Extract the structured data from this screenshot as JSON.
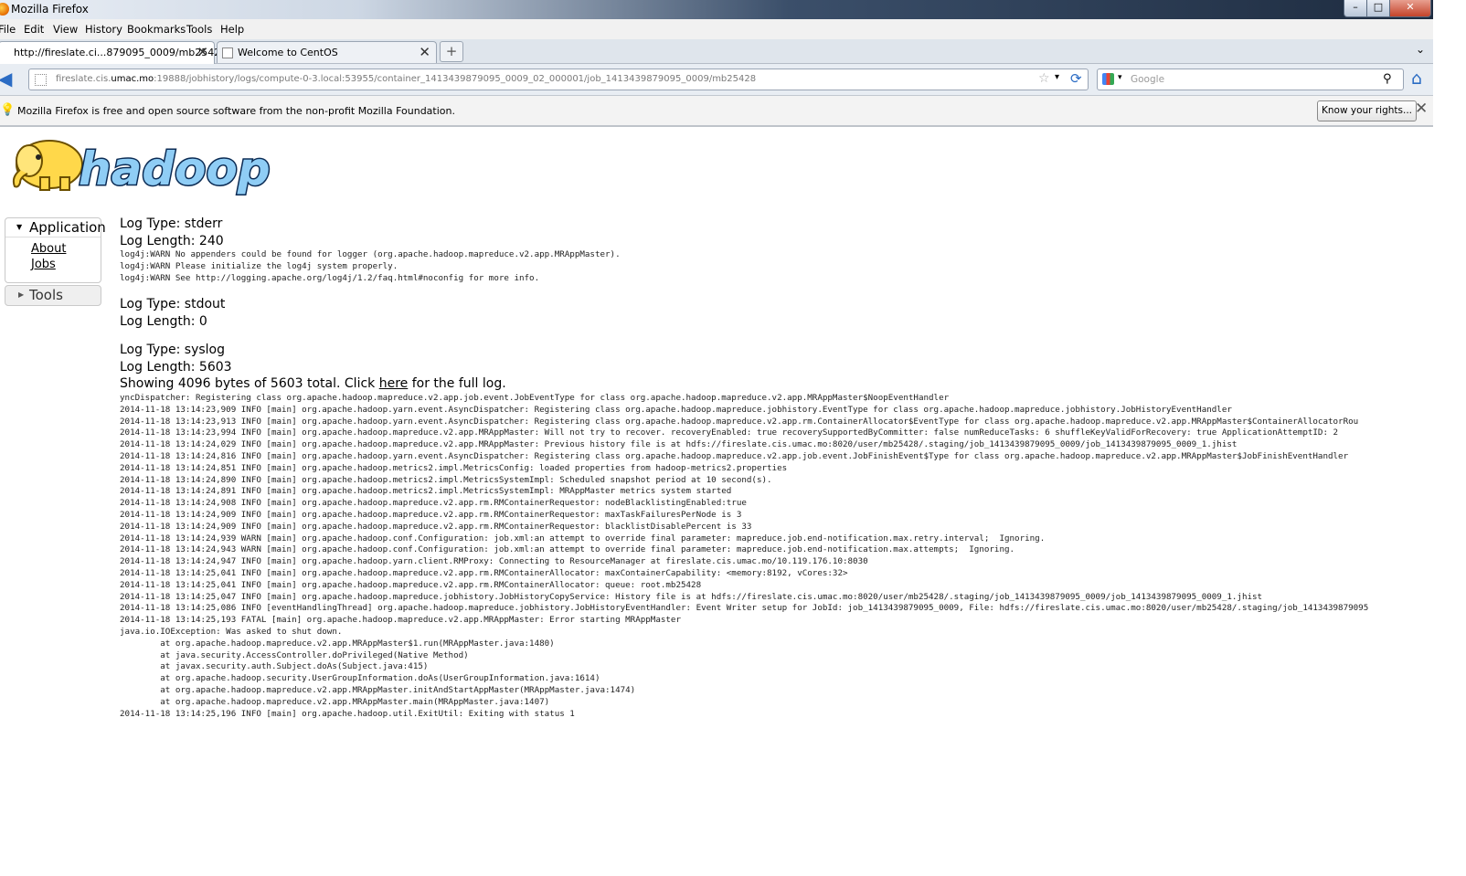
{
  "window": {
    "title": "Mozilla Firefox",
    "min": "–",
    "max": "□",
    "close": "✕"
  },
  "menu": [
    "File",
    "Edit",
    "View",
    "History",
    "Bookmarks",
    "Tools",
    "Help"
  ],
  "tabs": [
    {
      "label": "http://fireslate.ci...879095_0009/mb25428",
      "active": true
    },
    {
      "label": "Welcome to CentOS",
      "active": false
    }
  ],
  "newtab_label": "+",
  "nav": {
    "url_prefix": "fireslate.cis.",
    "url_host": "umac.mo",
    "url_rest": ":19888/jobhistory/logs/compute-0-3.local:53955/container_1413439879095_0009_02_000001/job_1413439879095_0009/mb25428",
    "search_placeholder": "Google"
  },
  "notification": {
    "message": "Mozilla Firefox is free and open source software from the non-profit Mozilla Foundation.",
    "button": "Know your rights..."
  },
  "sidebar": {
    "application": "Application",
    "links": [
      "About",
      "Jobs"
    ],
    "tools": "Tools"
  },
  "logs": {
    "stderr_type": "Log Type: stderr",
    "stderr_length": "Log Length: 240",
    "stderr_text": "log4j:WARN No appenders could be found for logger (org.apache.hadoop.mapreduce.v2.app.MRAppMaster).\nlog4j:WARN Please initialize the log4j system properly.\nlog4j:WARN See http://logging.apache.org/log4j/1.2/faq.html#noconfig for more info.",
    "stdout_type": "Log Type: stdout",
    "stdout_length": "Log Length: 0",
    "syslog_type": "Log Type: syslog",
    "syslog_length": "Log Length: 5603",
    "showing_prefix": "Showing 4096 bytes of 5603 total. Click ",
    "showing_link": "here",
    "showing_suffix": " for the full log.",
    "syslog_text": "yncDispatcher: Registering class org.apache.hadoop.mapreduce.v2.app.job.event.JobEventType for class org.apache.hadoop.mapreduce.v2.app.MRAppMaster$NoopEventHandler\n2014-11-18 13:14:23,909 INFO [main] org.apache.hadoop.yarn.event.AsyncDispatcher: Registering class org.apache.hadoop.mapreduce.jobhistory.EventType for class org.apache.hadoop.mapreduce.jobhistory.JobHistoryEventHandler\n2014-11-18 13:14:23,913 INFO [main] org.apache.hadoop.yarn.event.AsyncDispatcher: Registering class org.apache.hadoop.mapreduce.v2.app.rm.ContainerAllocator$EventType for class org.apache.hadoop.mapreduce.v2.app.MRAppMaster$ContainerAllocatorRou\n2014-11-18 13:14:23,994 INFO [main] org.apache.hadoop.mapreduce.v2.app.MRAppMaster: Will not try to recover. recoveryEnabled: true recoverySupportedByCommitter: false numReduceTasks: 6 shuffleKeyValidForRecovery: true ApplicationAttemptID: 2\n2014-11-18 13:14:24,029 INFO [main] org.apache.hadoop.mapreduce.v2.app.MRAppMaster: Previous history file is at hdfs://fireslate.cis.umac.mo:8020/user/mb25428/.staging/job_1413439879095_0009/job_1413439879095_0009_1.jhist\n2014-11-18 13:14:24,816 INFO [main] org.apache.hadoop.yarn.event.AsyncDispatcher: Registering class org.apache.hadoop.mapreduce.v2.app.job.event.JobFinishEvent$Type for class org.apache.hadoop.mapreduce.v2.app.MRAppMaster$JobFinishEventHandler\n2014-11-18 13:14:24,851 INFO [main] org.apache.hadoop.metrics2.impl.MetricsConfig: loaded properties from hadoop-metrics2.properties\n2014-11-18 13:14:24,890 INFO [main] org.apache.hadoop.metrics2.impl.MetricsSystemImpl: Scheduled snapshot period at 10 second(s).\n2014-11-18 13:14:24,891 INFO [main] org.apache.hadoop.metrics2.impl.MetricsSystemImpl: MRAppMaster metrics system started\n2014-11-18 13:14:24,908 INFO [main] org.apache.hadoop.mapreduce.v2.app.rm.RMContainerRequestor: nodeBlacklistingEnabled:true\n2014-11-18 13:14:24,909 INFO [main] org.apache.hadoop.mapreduce.v2.app.rm.RMContainerRequestor: maxTaskFailuresPerNode is 3\n2014-11-18 13:14:24,909 INFO [main] org.apache.hadoop.mapreduce.v2.app.rm.RMContainerRequestor: blacklistDisablePercent is 33\n2014-11-18 13:14:24,939 WARN [main] org.apache.hadoop.conf.Configuration: job.xml:an attempt to override final parameter: mapreduce.job.end-notification.max.retry.interval;  Ignoring.\n2014-11-18 13:14:24,943 WARN [main] org.apache.hadoop.conf.Configuration: job.xml:an attempt to override final parameter: mapreduce.job.end-notification.max.attempts;  Ignoring.\n2014-11-18 13:14:24,947 INFO [main] org.apache.hadoop.yarn.client.RMProxy: Connecting to ResourceManager at fireslate.cis.umac.mo/10.119.176.10:8030\n2014-11-18 13:14:25,041 INFO [main] org.apache.hadoop.mapreduce.v2.app.rm.RMContainerAllocator: maxContainerCapability: <memory:8192, vCores:32>\n2014-11-18 13:14:25,041 INFO [main] org.apache.hadoop.mapreduce.v2.app.rm.RMContainerAllocator: queue: root.mb25428\n2014-11-18 13:14:25,047 INFO [main] org.apache.hadoop.mapreduce.jobhistory.JobHistoryCopyService: History file is at hdfs://fireslate.cis.umac.mo:8020/user/mb25428/.staging/job_1413439879095_0009/job_1413439879095_0009_1.jhist\n2014-11-18 13:14:25,086 INFO [eventHandlingThread] org.apache.hadoop.mapreduce.jobhistory.JobHistoryEventHandler: Event Writer setup for JobId: job_1413439879095_0009, File: hdfs://fireslate.cis.umac.mo:8020/user/mb25428/.staging/job_1413439879095\n2014-11-18 13:14:25,193 FATAL [main] org.apache.hadoop.mapreduce.v2.app.MRAppMaster: Error starting MRAppMaster\njava.io.IOException: Was asked to shut down.\n        at org.apache.hadoop.mapreduce.v2.app.MRAppMaster$1.run(MRAppMaster.java:1480)\n        at java.security.AccessController.doPrivileged(Native Method)\n        at javax.security.auth.Subject.doAs(Subject.java:415)\n        at org.apache.hadoop.security.UserGroupInformation.doAs(UserGroupInformation.java:1614)\n        at org.apache.hadoop.mapreduce.v2.app.MRAppMaster.initAndStartAppMaster(MRAppMaster.java:1474)\n        at org.apache.hadoop.mapreduce.v2.app.MRAppMaster.main(MRAppMaster.java:1407)\n2014-11-18 13:14:25,196 INFO [main] org.apache.hadoop.util.ExitUtil: Exiting with status 1"
  },
  "colors": {
    "hadoop_blue": "#5aa7e0",
    "hadoop_navy": "#0b2b54",
    "elephant_yellow": "#ffd84a"
  }
}
